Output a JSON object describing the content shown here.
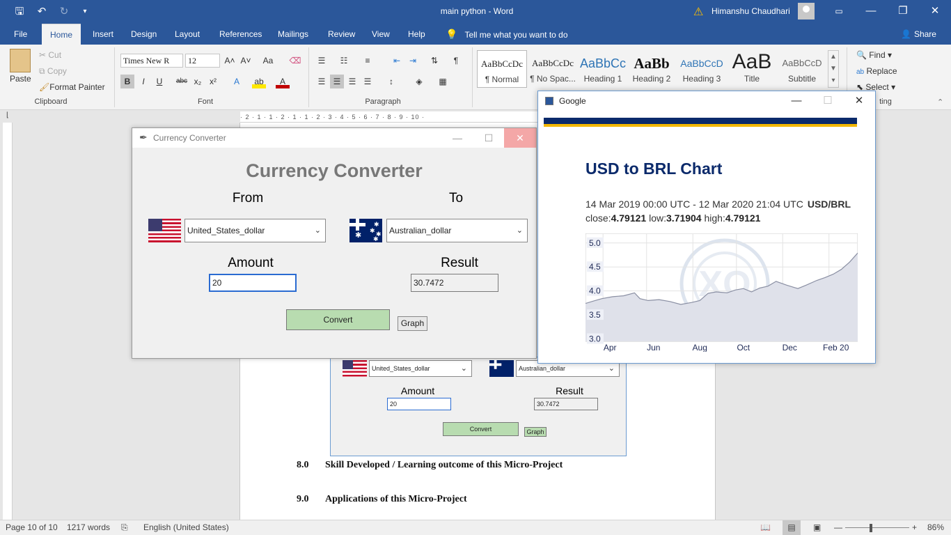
{
  "word": {
    "doc_title": "main python",
    "app_sep": "-",
    "app_name": "Word",
    "user": "Himanshu Chaudhari",
    "tabs": [
      "File",
      "Home",
      "Insert",
      "Design",
      "Layout",
      "References",
      "Mailings",
      "Review",
      "View",
      "Help"
    ],
    "tell_me": "Tell me what you want to do",
    "share": "Share",
    "clipboard": {
      "paste": "Paste",
      "cut": "Cut",
      "copy": "Copy",
      "format_painter": "Format Painter",
      "label": "Clipboard"
    },
    "font": {
      "name": "Times New R",
      "size": "12",
      "label": "Font",
      "bold": "B",
      "italic": "I",
      "underline": "U",
      "strike": "abc",
      "sub": "x₂",
      "sup": "x²",
      "grow": "A˄",
      "shrink": "A˅",
      "case": "Aa"
    },
    "paragraph": {
      "label": "Paragraph"
    },
    "styles": [
      {
        "preview": "AaBbCcDc",
        "name": "¶ Normal"
      },
      {
        "preview": "AaBbCcDc",
        "name": "¶ No Spac..."
      },
      {
        "preview": "AaBbCc",
        "name": "Heading 1"
      },
      {
        "preview": "AaBb",
        "name": "Heading 2"
      },
      {
        "preview": "AaBbCcD",
        "name": "Heading 3"
      },
      {
        "preview": "AaB",
        "name": "Title"
      },
      {
        "preview": "AaBbCcD",
        "name": "Subtitle"
      }
    ],
    "editing": {
      "find": "Find",
      "replace": "Replace",
      "select": "Select",
      "label_partial": "ting"
    },
    "ruler_text": "· 2 · 1 · 1 · 2 · 1 · 1 · 2 · 3 · 4 · 5 · 6 · 7 · 8 · 9 · 10 ·",
    "doc_headings": [
      {
        "num": "8.0",
        "text": "Skill Developed / Learning outcome of this Micro-Project"
      },
      {
        "num": "9.0",
        "text": "Applications of this Micro-Project"
      }
    ],
    "embed": {
      "from_value": "United_States_dollar",
      "to_value": "Australian_dollar",
      "amount_label": "Amount",
      "result_label": "Result",
      "amount": "20",
      "result": "30.7472",
      "convert": "Convert",
      "graph": "Graph"
    },
    "status": {
      "page": "Page 10 of 10",
      "words": "1217 words",
      "language": "English (United States)",
      "zoom": "86%"
    }
  },
  "converter": {
    "window_title": "Currency Converter",
    "heading": "Currency Converter",
    "from_label": "From",
    "to_label": "To",
    "from_value": "United_States_dollar",
    "to_value": "Australian_dollar",
    "amount_label": "Amount",
    "result_label": "Result",
    "amount": "20",
    "result": "30.7472",
    "convert_button": "Convert",
    "graph_button": "Graph"
  },
  "google": {
    "window_title": "Google",
    "heading": "USD to BRL Chart",
    "range": "14 Mar 2019 00:00 UTC - 12 Mar 2020 21:04 UTC",
    "pair": "USD/BRL",
    "close_label": "close:",
    "close": "4.79121",
    "low_label": "low:",
    "low": "3.71904",
    "high_label": "high:",
    "high": "4.79121",
    "watermark": "XO"
  },
  "chart_data": {
    "type": "area",
    "ylim": [
      2.95,
      5.2
    ],
    "yticks": [
      "5.0",
      "4.5",
      "4.0",
      "3.5",
      "3.0"
    ],
    "ytick_values": [
      5.0,
      4.5,
      4.0,
      3.5,
      3.0
    ],
    "xticks": [
      "Apr",
      "Jun",
      "Aug",
      "Oct",
      "Dec",
      "Feb 20"
    ],
    "xtick_positions": [
      0.09,
      0.25,
      0.42,
      0.58,
      0.75,
      0.92
    ],
    "x": [
      0,
      0.03,
      0.06,
      0.1,
      0.14,
      0.18,
      0.2,
      0.23,
      0.27,
      0.31,
      0.35,
      0.39,
      0.42,
      0.45,
      0.48,
      0.52,
      0.55,
      0.58,
      0.61,
      0.64,
      0.67,
      0.7,
      0.74,
      0.78,
      0.81,
      0.85,
      0.88,
      0.91,
      0.94,
      0.97,
      1.0
    ],
    "y": [
      3.74,
      3.79,
      3.84,
      3.88,
      3.9,
      3.96,
      3.84,
      3.8,
      3.82,
      3.78,
      3.72,
      3.76,
      3.8,
      3.95,
      3.98,
      3.96,
      4.02,
      4.05,
      3.98,
      4.06,
      4.1,
      4.2,
      4.12,
      4.05,
      4.12,
      4.22,
      4.28,
      4.35,
      4.45,
      4.6,
      4.79
    ],
    "grid": true,
    "legend": "none"
  }
}
